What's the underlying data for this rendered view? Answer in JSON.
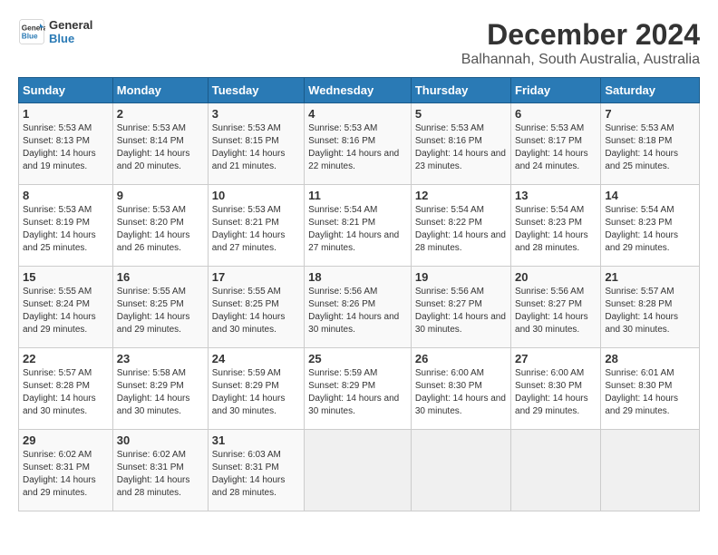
{
  "logo": {
    "line1": "General",
    "line2": "Blue"
  },
  "title": "December 2024",
  "subtitle": "Balhannah, South Australia, Australia",
  "headers": [
    "Sunday",
    "Monday",
    "Tuesday",
    "Wednesday",
    "Thursday",
    "Friday",
    "Saturday"
  ],
  "weeks": [
    [
      {
        "day": "1",
        "sunrise": "5:53 AM",
        "sunset": "8:13 PM",
        "daylight": "14 hours and 19 minutes."
      },
      {
        "day": "2",
        "sunrise": "5:53 AM",
        "sunset": "8:14 PM",
        "daylight": "14 hours and 20 minutes."
      },
      {
        "day": "3",
        "sunrise": "5:53 AM",
        "sunset": "8:15 PM",
        "daylight": "14 hours and 21 minutes."
      },
      {
        "day": "4",
        "sunrise": "5:53 AM",
        "sunset": "8:16 PM",
        "daylight": "14 hours and 22 minutes."
      },
      {
        "day": "5",
        "sunrise": "5:53 AM",
        "sunset": "8:16 PM",
        "daylight": "14 hours and 23 minutes."
      },
      {
        "day": "6",
        "sunrise": "5:53 AM",
        "sunset": "8:17 PM",
        "daylight": "14 hours and 24 minutes."
      },
      {
        "day": "7",
        "sunrise": "5:53 AM",
        "sunset": "8:18 PM",
        "daylight": "14 hours and 25 minutes."
      }
    ],
    [
      {
        "day": "8",
        "sunrise": "5:53 AM",
        "sunset": "8:19 PM",
        "daylight": "14 hours and 25 minutes."
      },
      {
        "day": "9",
        "sunrise": "5:53 AM",
        "sunset": "8:20 PM",
        "daylight": "14 hours and 26 minutes."
      },
      {
        "day": "10",
        "sunrise": "5:53 AM",
        "sunset": "8:21 PM",
        "daylight": "14 hours and 27 minutes."
      },
      {
        "day": "11",
        "sunrise": "5:54 AM",
        "sunset": "8:21 PM",
        "daylight": "14 hours and 27 minutes."
      },
      {
        "day": "12",
        "sunrise": "5:54 AM",
        "sunset": "8:22 PM",
        "daylight": "14 hours and 28 minutes."
      },
      {
        "day": "13",
        "sunrise": "5:54 AM",
        "sunset": "8:23 PM",
        "daylight": "14 hours and 28 minutes."
      },
      {
        "day": "14",
        "sunrise": "5:54 AM",
        "sunset": "8:23 PM",
        "daylight": "14 hours and 29 minutes."
      }
    ],
    [
      {
        "day": "15",
        "sunrise": "5:55 AM",
        "sunset": "8:24 PM",
        "daylight": "14 hours and 29 minutes."
      },
      {
        "day": "16",
        "sunrise": "5:55 AM",
        "sunset": "8:25 PM",
        "daylight": "14 hours and 29 minutes."
      },
      {
        "day": "17",
        "sunrise": "5:55 AM",
        "sunset": "8:25 PM",
        "daylight": "14 hours and 30 minutes."
      },
      {
        "day": "18",
        "sunrise": "5:56 AM",
        "sunset": "8:26 PM",
        "daylight": "14 hours and 30 minutes."
      },
      {
        "day": "19",
        "sunrise": "5:56 AM",
        "sunset": "8:27 PM",
        "daylight": "14 hours and 30 minutes."
      },
      {
        "day": "20",
        "sunrise": "5:56 AM",
        "sunset": "8:27 PM",
        "daylight": "14 hours and 30 minutes."
      },
      {
        "day": "21",
        "sunrise": "5:57 AM",
        "sunset": "8:28 PM",
        "daylight": "14 hours and 30 minutes."
      }
    ],
    [
      {
        "day": "22",
        "sunrise": "5:57 AM",
        "sunset": "8:28 PM",
        "daylight": "14 hours and 30 minutes."
      },
      {
        "day": "23",
        "sunrise": "5:58 AM",
        "sunset": "8:29 PM",
        "daylight": "14 hours and 30 minutes."
      },
      {
        "day": "24",
        "sunrise": "5:59 AM",
        "sunset": "8:29 PM",
        "daylight": "14 hours and 30 minutes."
      },
      {
        "day": "25",
        "sunrise": "5:59 AM",
        "sunset": "8:29 PM",
        "daylight": "14 hours and 30 minutes."
      },
      {
        "day": "26",
        "sunrise": "6:00 AM",
        "sunset": "8:30 PM",
        "daylight": "14 hours and 30 minutes."
      },
      {
        "day": "27",
        "sunrise": "6:00 AM",
        "sunset": "8:30 PM",
        "daylight": "14 hours and 29 minutes."
      },
      {
        "day": "28",
        "sunrise": "6:01 AM",
        "sunset": "8:30 PM",
        "daylight": "14 hours and 29 minutes."
      }
    ],
    [
      {
        "day": "29",
        "sunrise": "6:02 AM",
        "sunset": "8:31 PM",
        "daylight": "14 hours and 29 minutes."
      },
      {
        "day": "30",
        "sunrise": "6:02 AM",
        "sunset": "8:31 PM",
        "daylight": "14 hours and 28 minutes."
      },
      {
        "day": "31",
        "sunrise": "6:03 AM",
        "sunset": "8:31 PM",
        "daylight": "14 hours and 28 minutes."
      },
      null,
      null,
      null,
      null
    ]
  ]
}
